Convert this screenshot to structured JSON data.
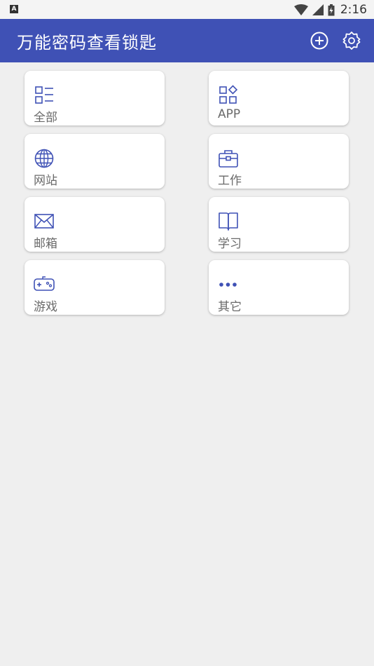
{
  "status_bar": {
    "indicator": "A",
    "time": "2:16",
    "icons": [
      "wifi-icon",
      "signal-icon",
      "battery-charging-icon"
    ]
  },
  "app_bar": {
    "title": "万能密码查看锁匙",
    "actions": [
      "add-circle-icon",
      "settings-icon"
    ],
    "color": "#3f51b5"
  },
  "categories": [
    {
      "label": "全部",
      "icon": "list-icon"
    },
    {
      "label": "APP",
      "icon": "apps-icon"
    },
    {
      "label": "网站",
      "icon": "globe-icon"
    },
    {
      "label": "工作",
      "icon": "briefcase-icon"
    },
    {
      "label": "邮箱",
      "icon": "mail-icon"
    },
    {
      "label": "学习",
      "icon": "book-icon"
    },
    {
      "label": "游戏",
      "icon": "gamepad-icon"
    },
    {
      "label": "其它",
      "icon": "more-icon"
    }
  ]
}
